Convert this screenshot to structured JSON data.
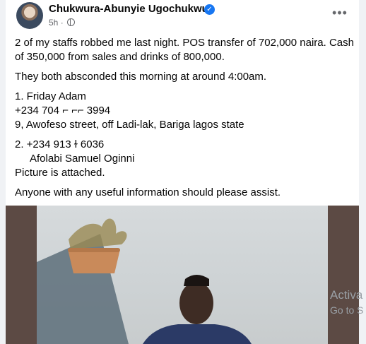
{
  "post": {
    "author": "Chukwura-Abunyie Ugochukwu",
    "time": "5h",
    "separator": "·",
    "more_label": "•••",
    "paragraphs": [
      "2 of my staffs robbed me last night. POS transfer of 702,000 naira. Cash of 350,000 from sales and drinks of 800,000.",
      "They both absconded this morning at around 4:00am."
    ],
    "suspect1": {
      "name_line": "1. Friday Adam",
      "phone": "+234 704 ⌐ ⌐⌐ 3994",
      "address": "9, Awofeso street, off Ladi-lak, Bariga lagos state"
    },
    "suspect2": {
      "phone_line": "2. +234 913      ɫ 6036",
      "name": "Afolabi Samuel Oginni",
      "attachment_note": "Picture is attached."
    },
    "closing": "Anyone with any useful information should please assist."
  },
  "overlay": {
    "line1": "Activa",
    "line2": "Go to S"
  },
  "colors": {
    "verified_badge": "#1877f2",
    "photo_frame": "#5c4a44",
    "wall": "#cdd2d4"
  }
}
